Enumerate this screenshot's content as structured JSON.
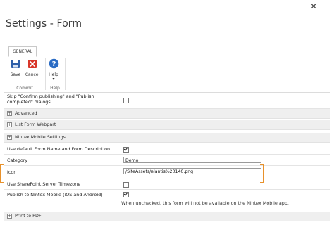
{
  "window": {
    "close_glyph": "✕"
  },
  "page": {
    "title": "Settings - Form"
  },
  "ribbon": {
    "tab": "GENERAL",
    "buttons": [
      {
        "label": "Save",
        "icon": "save-icon"
      },
      {
        "label": "Cancel",
        "icon": "cancel-icon"
      },
      {
        "label": "Help",
        "icon": "help-icon",
        "arrow": "▾"
      }
    ],
    "groups": [
      {
        "label": "Commit"
      },
      {
        "label": "Help"
      }
    ],
    "colors": {
      "save": "#2f5fa8",
      "cancel": "#d9372b",
      "help": "#2b6cc4"
    }
  },
  "form": {
    "skip_publishing": {
      "label": "Skip \"Confirm publishing\" and \"Publish completed\" dialogs",
      "checked": false
    },
    "sections": {
      "advanced": "Advanced",
      "list_form_webpart": "List Form Webpart",
      "nintex_mobile": "Nintex Mobile Settings",
      "print_pdf": "Print to PDF"
    },
    "section_glyph": "+",
    "use_default_name": {
      "label": "Use default Form Name and Form Description",
      "checked": true
    },
    "category": {
      "label": "Category",
      "value": "Demo"
    },
    "icon": {
      "label": "Icon",
      "value": "/SiteAssets/elantis%20140.png"
    },
    "use_sp_timezone": {
      "label": "Use SharePoint Server Timezone",
      "checked": false
    },
    "publish_mobile": {
      "label": "Publish to Nintex Mobile (iOS and Android)",
      "checked": true,
      "note": "When unchecked, this form will not be available on the Nintex Mobile app."
    },
    "highlight_color": "#e8912b"
  }
}
